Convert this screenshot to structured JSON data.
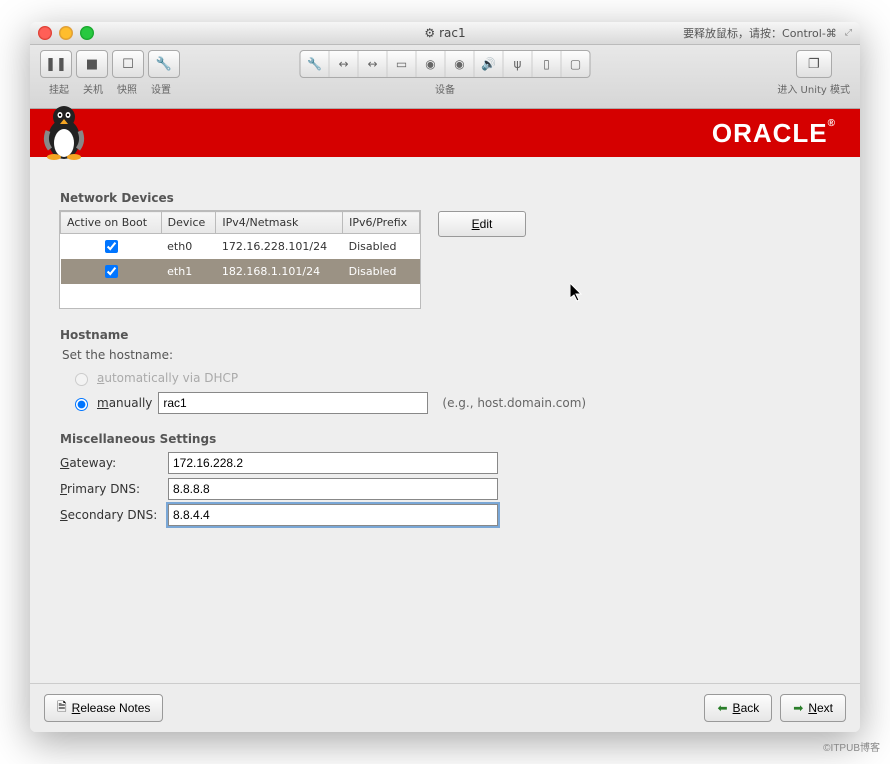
{
  "titlebar": {
    "title": "rac1",
    "right_hint": "要释放鼠标，请按：Control-⌘"
  },
  "toolbar": {
    "suspend": "挂起",
    "poweroff": "关机",
    "snapshot": "快照",
    "settings": "设置",
    "devices": "设备",
    "unity": "进入 Unity 模式"
  },
  "oracle": {
    "brand": "ORACLE"
  },
  "network": {
    "title": "Network Devices",
    "cols": {
      "active": "Active on Boot",
      "device": "Device",
      "ipv4": "IPv4/Netmask",
      "ipv6": "IPv6/Prefix"
    },
    "rows": [
      {
        "checked": true,
        "device": "eth0",
        "ipv4": "172.16.228.101/24",
        "ipv6": "Disabled"
      },
      {
        "checked": true,
        "device": "eth1",
        "ipv4": "182.168.1.101/24",
        "ipv6": "Disabled"
      }
    ],
    "edit": "Edit"
  },
  "hostname": {
    "title": "Hostname",
    "prompt": "Set the hostname:",
    "auto_label": "automatically via DHCP",
    "manual_label": "manually",
    "manual_underline": "m",
    "value": "rac1",
    "hint": "(e.g., host.domain.com)"
  },
  "misc": {
    "title": "Miscellaneous Settings",
    "gateway_label": "Gateway:",
    "gateway_value": "172.16.228.2",
    "primary_label": "Primary DNS:",
    "primary_value": "8.8.8.8",
    "secondary_label": "Secondary DNS:",
    "secondary_value": "8.8.4.4"
  },
  "footer": {
    "release_notes": "Release Notes",
    "back": "Back",
    "next": "Next"
  },
  "watermark": "©ITPUB博客"
}
